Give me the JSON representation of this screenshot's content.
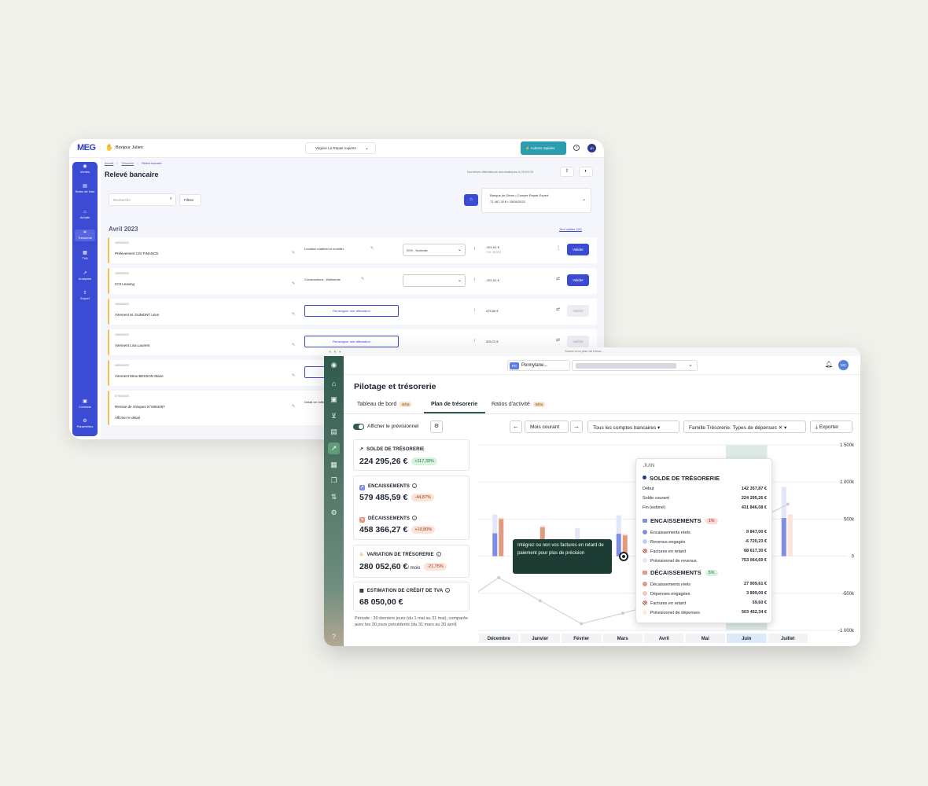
{
  "meg": {
    "logo": "MEG",
    "greeting": "Bonjour Julien",
    "company": "Virginie La Repair experts",
    "quick_actions": "Actions rapides",
    "avatar": "JD",
    "sidebar": [
      {
        "label": "Ventes",
        "icon": "ventes-icon"
      },
      {
        "label": "Notes de frais",
        "icon": "receipt-icon"
      },
      {
        "label": "Achats",
        "icon": "cart-icon"
      },
      {
        "label": "Trésorerie",
        "icon": "bank-icon"
      },
      {
        "label": "TVA",
        "icon": "calendar-icon"
      },
      {
        "label": "Analyses",
        "icon": "chart-icon"
      },
      {
        "label": "Export",
        "icon": "export-icon"
      },
      {
        "label": "Contacts",
        "icon": "contacts-icon"
      },
      {
        "label": "Paramètres",
        "icon": "settings-icon"
      }
    ],
    "breadcrumb": [
      "Accueil",
      "Trésorerie",
      "Relevé bancaire"
    ],
    "title": "Relevé bancaire",
    "last_assignments": "Dernières affectations automatiques à 09:09:25",
    "search_placeholder": "Recherche",
    "filters": "Filtres",
    "bank": {
      "line1": "Banque de Démo  •  Compte Repair Expert",
      "line2": "72 487,30 €  •  15/04/2023"
    },
    "month": "Avril 2023",
    "validate_all": "Tout valider (10)",
    "rows": [
      {
        "date": "19/04/2023",
        "label": "Prélèvement CGI FINANCE",
        "category": "Location matériel et mobilier",
        "select": "20% - Normale",
        "amount": "-521,61 €",
        "tva": "TVA : 86,94 €",
        "action": "Valider",
        "enabled": true
      },
      {
        "date": "19/04/2023",
        "label": "CGI Leasing",
        "category": "Constructions - Bâtiments",
        "select": "",
        "amount": "-521,61 €",
        "tva": "",
        "action": "Valider",
        "enabled": true
      },
      {
        "date": "19/04/2023",
        "label": "Virement M. DUMONT Léon",
        "renseigner": "Renseigner une affectation",
        "amount": "475,66 €",
        "action": "Valider",
        "enabled": false
      },
      {
        "date": "19/04/2023",
        "label": "Virement Lina Laurent",
        "renseigner": "Renseigner une affectation",
        "amount": "325,72 €",
        "action": "Valider",
        "enabled": false
      },
      {
        "date": "18/04/2023",
        "label": "Virement Mme BESSON Marie",
        "renseigner": "Renseigner une affectation",
        "amount": "",
        "action": "",
        "enabled": false
      },
      {
        "date": "07/04/2023",
        "label": "Remise de chèques N°5084487",
        "category": "Détail de l'affectation",
        "detail": "Afficher le détail",
        "amount": "",
        "action": "",
        "enabled": false
      }
    ]
  },
  "pennylane": {
    "tab_title": "Suivez mon plan de trésor...",
    "company_badge": "PC",
    "company": "Pennylane...",
    "avatar": "MC",
    "title": "Pilotage et trésorerie",
    "tabs": [
      {
        "label": "Tableau de bord",
        "beta": "Bêta"
      },
      {
        "label": "Plan de trésorerie",
        "beta": ""
      },
      {
        "label": "Ratios d'activité",
        "beta": "Bêta"
      }
    ],
    "forecast_label": "Afficher le prévisionnel",
    "period_button": "Mois courant",
    "accounts_button": "Tous les comptes bancaires",
    "family_button": "Famille Trésorerie: Types de dépenses",
    "export_button": "Exporter",
    "kpis": {
      "solde": {
        "title": "SOLDE DE TRÉSORERIE",
        "value": "224 295,26 €",
        "chip": "+117,39%"
      },
      "encaissements": {
        "title": "ENCAISSEMENTS",
        "value": "579 485,59 €",
        "chip": "-44,87%"
      },
      "decaissements": {
        "title": "DÉCAISSEMENTS",
        "value": "458 366,27 €",
        "chip": "+19,80%"
      },
      "variation": {
        "title": "VARIATION DE TRÉSORERIE",
        "value": "280 052,60 €",
        "unit": "/ mois",
        "chip": "-21,75%"
      },
      "tva": {
        "title": "ESTIMATION DE CRÉDIT DE TVA",
        "value": "68 050,00 €"
      }
    },
    "period_note": "Période : 30 derniers jours (du 1 mai au 31 mai), comparée avec les 30 jours précédents (du 31 mars au 30 avril)",
    "dark_tooltip": "Intégrez ou non vos factures en retard de paiement pour plus de précision",
    "tooltip": {
      "month": "JUIN",
      "solde_title": "SOLDE DE TRÉSORERIE",
      "solde_lines": [
        {
          "label": "Début",
          "value": "142 357,87 €"
        },
        {
          "label": "Solde courant",
          "value": "224 295,26 €"
        },
        {
          "label": "Fin (estimé)",
          "value": "431 846,08 €"
        }
      ],
      "enc_title": "ENCAISSEMENTS",
      "enc_pct": "1%",
      "enc_lines": [
        {
          "label": "Encaissements réels",
          "value": "9 847,00 €"
        },
        {
          "label": "Revenus engagés",
          "value": "-6 720,23 €"
        },
        {
          "label": "Factures en retard",
          "value": "68 617,30 €"
        },
        {
          "label": "Prévisionnel de revenus",
          "value": "753 064,69 €"
        }
      ],
      "dec_title": "DÉCAISSEMENTS",
      "dec_pct": "5%",
      "dec_lines": [
        {
          "label": "Décaissements réels",
          "value": "27 909,61 €"
        },
        {
          "label": "Dépenses engagées",
          "value": "3 899,00 €"
        },
        {
          "label": "Factures en retard",
          "value": "59,60 €"
        },
        {
          "label": "Prévisionnel de dépenses",
          "value": "503 452,34 €"
        }
      ]
    }
  },
  "chart_data": {
    "type": "bar",
    "categories": [
      "Décembre",
      "Janvier",
      "Février",
      "Mars",
      "Avril",
      "Mai",
      "Juin",
      "Juillet"
    ],
    "highlighted": "Juin",
    "y_tick_labels": [
      "1 500k",
      "1 000k",
      "500k",
      "0",
      "-500k",
      "-1 000k"
    ],
    "ylim": [
      -1000000,
      1500000
    ],
    "series": [
      {
        "name": "ENCAISSEMENTS",
        "color": "#7f8ee0",
        "values": [
          560000,
          null,
          380000,
          550000,
          null,
          null,
          825000,
          935000
        ]
      },
      {
        "name": "DÉCAISSEMENTS",
        "color": "#e09a80",
        "values": [
          520000,
          410000,
          null,
          300000,
          null,
          null,
          530000,
          560000
        ]
      },
      {
        "name": "SOLDE DE TRÉSORERIE",
        "color": "#c8cdd6",
        "values": [
          -290000,
          -600000,
          -910000,
          -770000,
          -620000,
          -420000,
          420000,
          700000
        ]
      }
    ],
    "grid": true
  }
}
